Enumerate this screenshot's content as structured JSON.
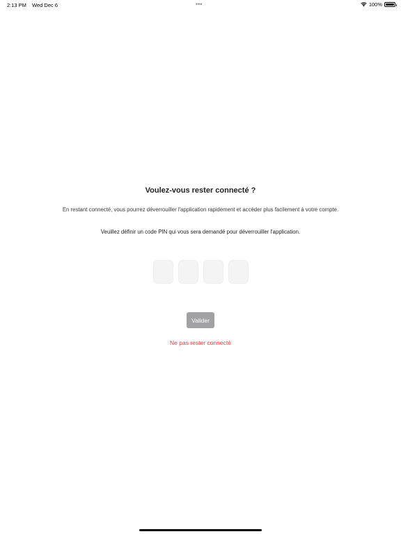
{
  "status_bar": {
    "time": "2:13 PM",
    "date": "Wed Dec 6",
    "battery": "100%",
    "battery_level": 1.0,
    "wifi_icon": "wifi-icon",
    "multitask_icon": "ellipsis-icon"
  },
  "dialog": {
    "title": "Voulez-vous rester connecté ?",
    "subtitle": "En restant connecté, vous pourrez déverrouiller l'application rapidement et accéder plus facilement à votre compte.",
    "instruction": "Veuillez définir un code PIN qui vous sera demandé pour déverrouiller l'application.",
    "pin_digits": [
      "",
      "",
      "",
      ""
    ],
    "validate_label": "Valider",
    "decline_label": "Ne pas rester connecté"
  },
  "colors": {
    "button_disabled": "#a1a1a6",
    "decline_text": "#e8383d",
    "pin_box_bg": "#f4f4f4"
  }
}
